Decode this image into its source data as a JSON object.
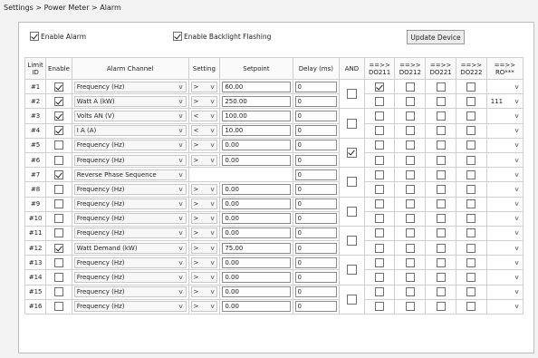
{
  "breadcrumb": "Settings > Power Meter > Alarm",
  "enable_alarm": {
    "label": "Enable Alarm",
    "checked": true
  },
  "enable_backlight": {
    "label": "Enable Backlight Flashing",
    "checked": true
  },
  "update_button": "Update Device",
  "headers": {
    "limit_id": "Limit ID",
    "enable": "Enable",
    "channel": "Alarm Channel",
    "setting": "Setting",
    "setpoint": "Setpoint",
    "delay": "Delay (ms)",
    "and": "AND",
    "do211": "==>> DO211",
    "do212": "==>> DO212",
    "do221": "==>> DO221",
    "do222": "==>> DO222",
    "ro": "==>> RO***"
  },
  "rows": [
    {
      "id": "#1",
      "enable": true,
      "channel": "Frequency (Hz)",
      "setting": ">",
      "setpoint": "60.00",
      "delay": "0",
      "do211": true,
      "do212": false,
      "do221": false,
      "do222": false,
      "ro": ""
    },
    {
      "id": "#2",
      "enable": true,
      "channel": "Watt A (kW)",
      "setting": ">",
      "setpoint": "250.00",
      "delay": "0",
      "do211": false,
      "do212": false,
      "do221": false,
      "do222": false,
      "ro": "111"
    },
    {
      "id": "#3",
      "enable": true,
      "channel": "Volts AN (V)",
      "setting": "<",
      "setpoint": "100.00",
      "delay": "0",
      "do211": false,
      "do212": false,
      "do221": false,
      "do222": false,
      "ro": ""
    },
    {
      "id": "#4",
      "enable": true,
      "channel": "I A (A)",
      "setting": "<",
      "setpoint": "10.00",
      "delay": "0",
      "do211": false,
      "do212": false,
      "do221": false,
      "do222": false,
      "ro": ""
    },
    {
      "id": "#5",
      "enable": false,
      "channel": "Frequency (Hz)",
      "setting": ">",
      "setpoint": "0.00",
      "delay": "0",
      "do211": false,
      "do212": false,
      "do221": false,
      "do222": false,
      "ro": ""
    },
    {
      "id": "#6",
      "enable": false,
      "channel": "Frequency (Hz)",
      "setting": ">",
      "setpoint": "0.00",
      "delay": "0",
      "do211": false,
      "do212": false,
      "do221": false,
      "do222": false,
      "ro": ""
    },
    {
      "id": "#7",
      "enable": true,
      "channel": "Reverse Phase Sequence",
      "setting": "",
      "setpoint": "",
      "delay": "0",
      "do211": false,
      "do212": false,
      "do221": false,
      "do222": false,
      "ro": ""
    },
    {
      "id": "#8",
      "enable": false,
      "channel": "Frequency (Hz)",
      "setting": ">",
      "setpoint": "0.00",
      "delay": "0",
      "do211": false,
      "do212": false,
      "do221": false,
      "do222": false,
      "ro": ""
    },
    {
      "id": "#9",
      "enable": false,
      "channel": "Frequency (Hz)",
      "setting": ">",
      "setpoint": "0.00",
      "delay": "0",
      "do211": false,
      "do212": false,
      "do221": false,
      "do222": false,
      "ro": ""
    },
    {
      "id": "#10",
      "enable": false,
      "channel": "Frequency (Hz)",
      "setting": ">",
      "setpoint": "0.00",
      "delay": "0",
      "do211": false,
      "do212": false,
      "do221": false,
      "do222": false,
      "ro": ""
    },
    {
      "id": "#11",
      "enable": false,
      "channel": "Frequency (Hz)",
      "setting": ">",
      "setpoint": "0.00",
      "delay": "0",
      "do211": false,
      "do212": false,
      "do221": false,
      "do222": false,
      "ro": ""
    },
    {
      "id": "#12",
      "enable": true,
      "channel": "Watt Demand (kW)",
      "setting": ">",
      "setpoint": "75.00",
      "delay": "0",
      "do211": false,
      "do212": false,
      "do221": false,
      "do222": false,
      "ro": ""
    },
    {
      "id": "#13",
      "enable": false,
      "channel": "Frequency (Hz)",
      "setting": ">",
      "setpoint": "0.00",
      "delay": "0",
      "do211": false,
      "do212": false,
      "do221": false,
      "do222": false,
      "ro": ""
    },
    {
      "id": "#14",
      "enable": false,
      "channel": "Frequency (Hz)",
      "setting": ">",
      "setpoint": "0.00",
      "delay": "0",
      "do211": false,
      "do212": false,
      "do221": false,
      "do222": false,
      "ro": ""
    },
    {
      "id": "#15",
      "enable": false,
      "channel": "Frequency (Hz)",
      "setting": ">",
      "setpoint": "0.00",
      "delay": "0",
      "do211": false,
      "do212": false,
      "do221": false,
      "do222": false,
      "ro": ""
    },
    {
      "id": "#16",
      "enable": false,
      "channel": "Frequency (Hz)",
      "setting": ">",
      "setpoint": "0.00",
      "delay": "0",
      "do211": false,
      "do212": false,
      "do221": false,
      "do222": false,
      "ro": ""
    }
  ],
  "and_groups": [
    false,
    false,
    true,
    false,
    false,
    false,
    false,
    false
  ]
}
